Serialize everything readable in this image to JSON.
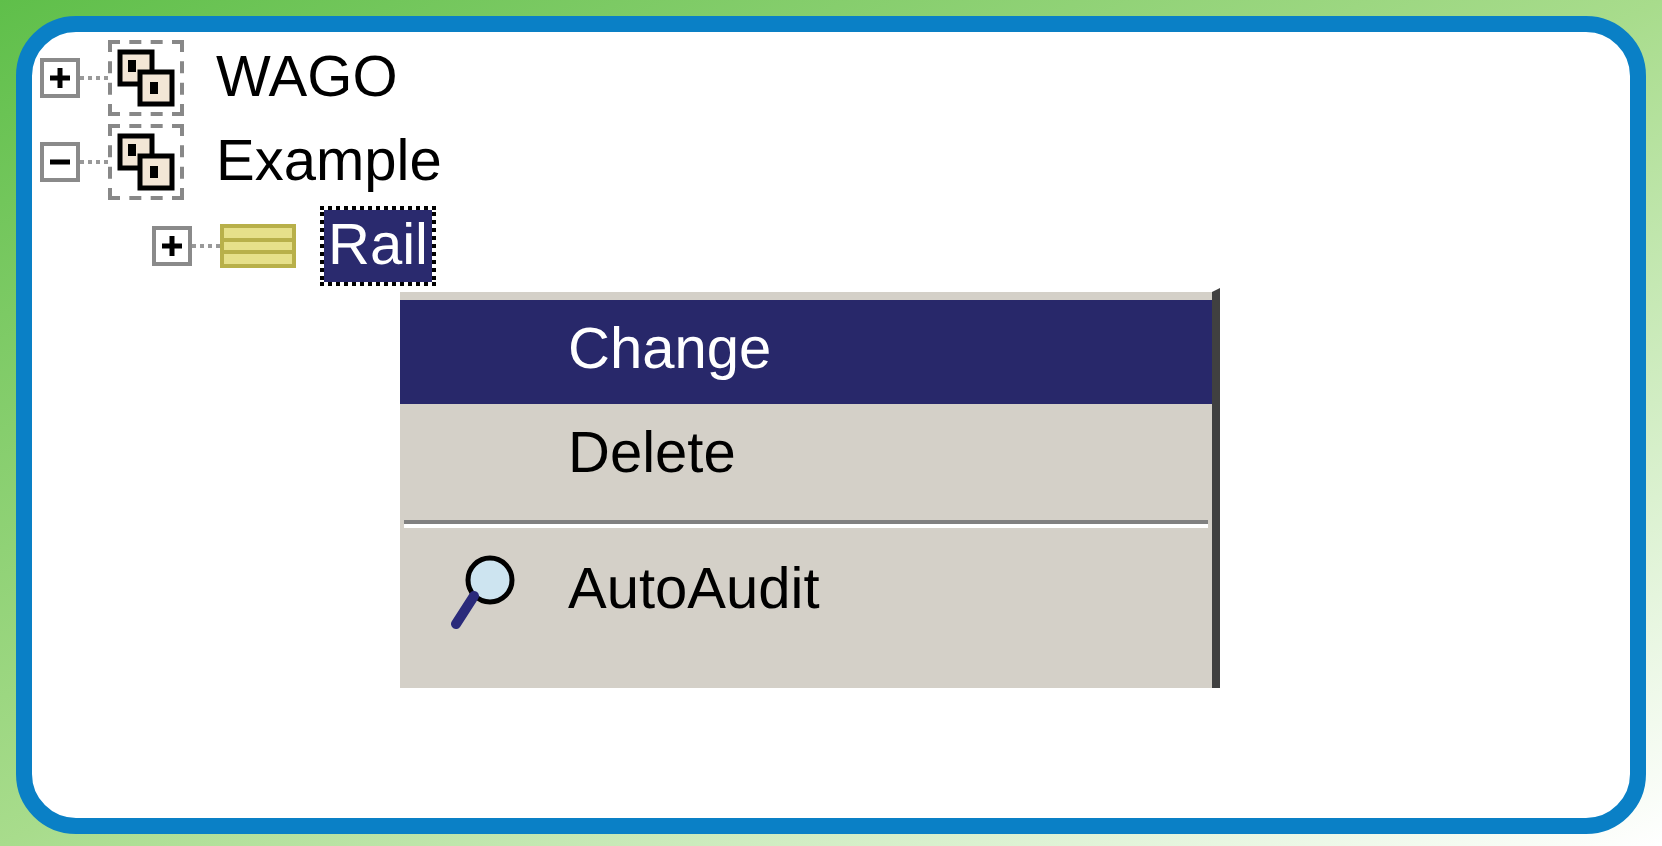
{
  "tree": [
    {
      "label": "WAGO",
      "kind": "node",
      "expanded": false,
      "selected": false
    },
    {
      "label": "Example",
      "kind": "node",
      "expanded": true,
      "selected": false,
      "children": [
        {
          "label": "Rail",
          "kind": "rail",
          "expanded": false,
          "selected": true
        }
      ]
    }
  ],
  "context_menu": {
    "groups": [
      [
        {
          "label": "Change",
          "selected": true
        },
        {
          "label": "Delete",
          "selected": false
        }
      ],
      [
        {
          "label": "AutoAudit",
          "selected": false,
          "kind": "audit"
        }
      ]
    ]
  }
}
